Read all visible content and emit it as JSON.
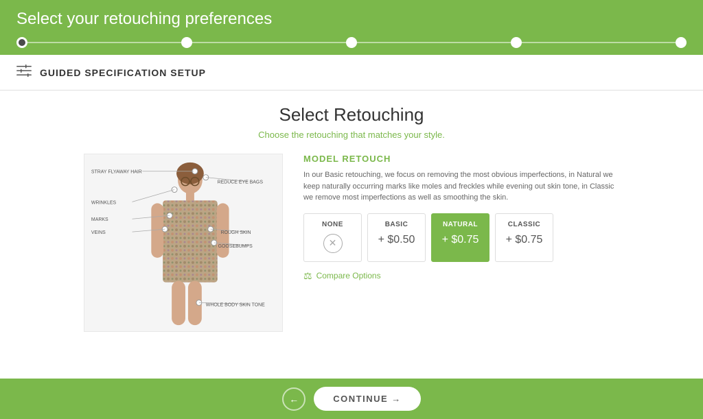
{
  "header": {
    "title": "Select your retouching preferences",
    "progress": {
      "steps": [
        {
          "id": 1,
          "active": true
        },
        {
          "id": 2,
          "active": false
        },
        {
          "id": 3,
          "active": false
        },
        {
          "id": 4,
          "active": false
        },
        {
          "id": 5,
          "active": false
        }
      ]
    }
  },
  "sub_header": {
    "title": "GUIDED SPECIFICATION SETUP",
    "icon": "sliders-icon"
  },
  "section": {
    "title": "Select Retouching",
    "subtitle_plain": "Choose ",
    "subtitle_colored": "the retouching that matches your style.",
    "panel_title": "MODEL RETOUCH",
    "description": "In our Basic retouching, we focus on removing the most obvious imperfections, in Natural we keep naturally occurring marks like moles and freckles while evening out skin tone, in Classic we remove most imperfections as well as smoothing the skin.",
    "annotations": [
      {
        "label": "STRAY FLYAWAY HAIR",
        "side": "left",
        "top": "10%"
      },
      {
        "label": "REDUCE EYE BAGS",
        "side": "right",
        "top": "20%"
      },
      {
        "label": "WRINKLES",
        "side": "left",
        "top": "32%"
      },
      {
        "label": "MARKS",
        "side": "left",
        "top": "45%"
      },
      {
        "label": "VEINS",
        "side": "left",
        "top": "53%"
      },
      {
        "label": "ROUGH SKIN",
        "side": "right",
        "top": "53%"
      },
      {
        "label": "GOOSEBUMPS",
        "side": "right",
        "top": "62%"
      },
      {
        "label": "WHOLE BODY SKIN TONE",
        "side": "right",
        "top": "85%"
      }
    ],
    "options": [
      {
        "id": "none",
        "label": "NONE",
        "price": "",
        "icon": "x-icon",
        "selected": false
      },
      {
        "id": "basic",
        "label": "BASIC",
        "price": "+ $0.50",
        "icon": null,
        "selected": false
      },
      {
        "id": "natural",
        "label": "NATURAL",
        "price": "+ $0.75",
        "icon": null,
        "selected": true
      },
      {
        "id": "classic",
        "label": "CLASSIC",
        "price": "+ $0.75",
        "icon": null,
        "selected": false
      }
    ],
    "compare_link": "Compare Options"
  },
  "footer": {
    "back_label": "←",
    "continue_label": "CONTINUE →"
  }
}
